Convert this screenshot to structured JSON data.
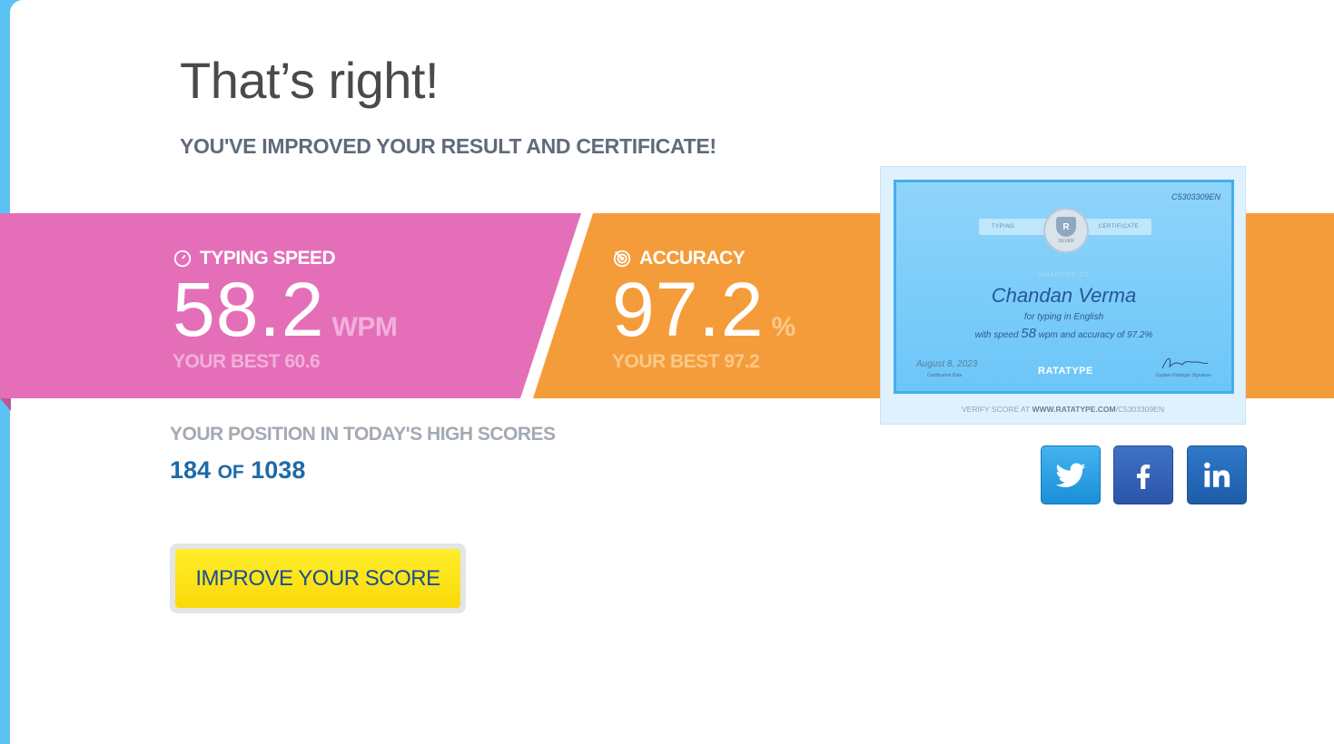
{
  "header": {
    "title": "That’s right!",
    "subtitle": "YOU'VE IMPROVED YOUR RESULT AND CERTIFICATE!"
  },
  "speed": {
    "label": "TYPING SPEED",
    "icon": "speedometer-icon",
    "value": "58.2",
    "unit": "WPM",
    "best": "YOUR BEST 60.6"
  },
  "accuracy": {
    "label": "ACCURACY",
    "icon": "target-icon",
    "value": "97.2",
    "unit": "%",
    "best": "YOUR BEST 97.2"
  },
  "certificate": {
    "id": "C5303309EN",
    "ribbon_left": "TYPING",
    "ribbon_right": "CERTIFICATE",
    "badge_logo": "R",
    "badge": "SILVER",
    "awarded": "AWARDED TO",
    "name": "Chandan Verma",
    "for_line": "for typing in English",
    "with_prefix": "with speed",
    "speed": "58",
    "with_suffix": "wpm and accuracy of 97.2%",
    "date": "August 8, 2023",
    "date_label": "Certification Date",
    "brand": "RATATYPE",
    "signature_label": "Captain Ratatype Signature",
    "verify_prefix": "VERIFY SCORE AT",
    "verify_url": "WWW.RATATYPE.COM",
    "verify_path": "/C5303309EN"
  },
  "position": {
    "label": "YOUR POSITION IN TODAY'S HIGH SCORES",
    "rank": "184",
    "of": "OF",
    "total": "1038"
  },
  "social": {
    "twitter": "twitter-icon",
    "facebook": "facebook-icon",
    "linkedin": "linkedin-icon"
  },
  "actions": {
    "improve": "IMPROVE YOUR SCORE"
  },
  "colors": {
    "pink": "#e46fb8",
    "orange": "#f59c3a",
    "blue_text": "#1f6aa8",
    "button_yellow": "#fbd90a"
  }
}
